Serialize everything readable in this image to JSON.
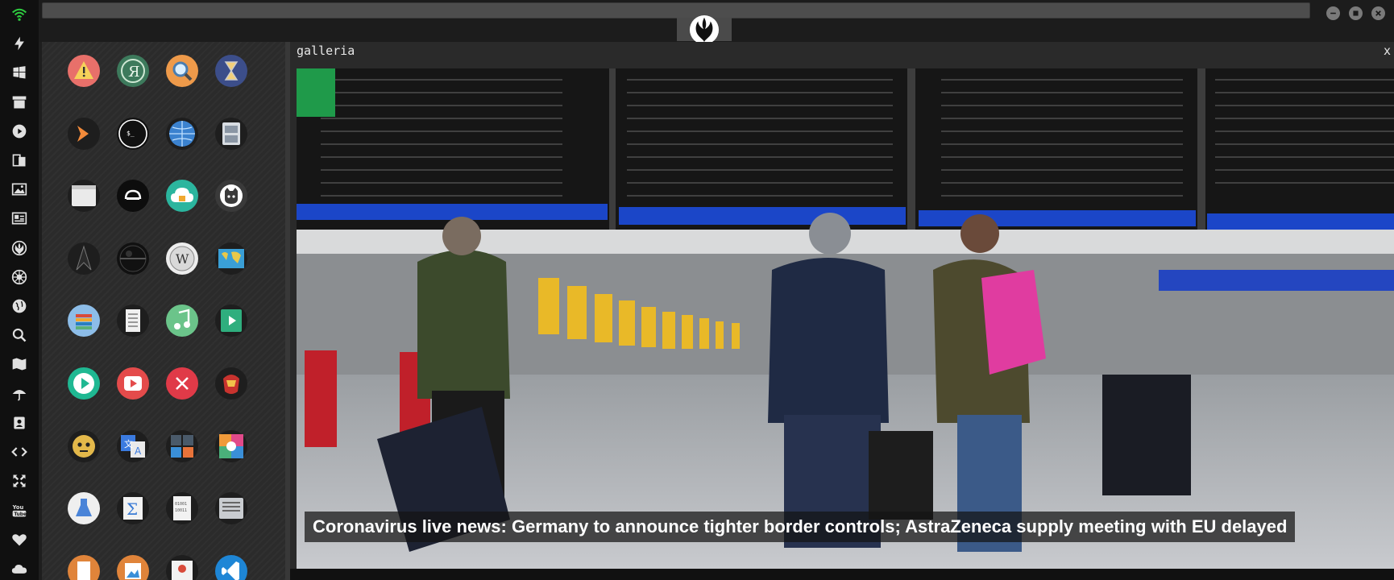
{
  "browser": {
    "url": "",
    "active_tab_icon": "rebel-alliance-icon",
    "window_controls": [
      "minimize-icon",
      "maximize-icon",
      "close-icon"
    ]
  },
  "dock": {
    "items": [
      "wifi-icon",
      "bolt-icon",
      "windows-icon",
      "archive-icon",
      "play-circle-icon",
      "translate-icon",
      "image-icon",
      "newspaper-icon",
      "rebel-alliance-icon",
      "empire-icon",
      "globe-icon",
      "search-icon",
      "map-icon",
      "umbrella-icon",
      "contact-icon",
      "code-icon",
      "expand-icon",
      "youtube-icon",
      "heart-icon",
      "cloud-icon"
    ],
    "colors": {
      "wifi": "#2ecc40",
      "default": "#e0e0e0"
    }
  },
  "apps": [
    "warning-icon",
    "yandex-icon",
    "search-icon",
    "hourglass-icon",
    "terminal-prompt-icon",
    "console-icon",
    "globe-icon",
    "file-cabinet-icon",
    "window-icon",
    "typing-icon",
    "cloud-lock-icon",
    "github-icon",
    "starfleet-icon",
    "death-star-icon",
    "wikipedia-icon",
    "world-map-icon",
    "books-icon",
    "document-icon",
    "music-icon",
    "video-icon",
    "play-icon",
    "youtube-icon",
    "close-circle-icon",
    "iron-man-icon",
    "c3po-icon",
    "translate-icon",
    "calculator-icon",
    "photo-viewer-icon",
    "flask-icon",
    "sigma-icon",
    "binary-file-icon",
    "text-editor-icon",
    "document-orange-icon",
    "image-orange-icon",
    "presentation-icon",
    "vscode-icon"
  ],
  "gallery": {
    "title": "galleria",
    "close_label": "x",
    "caption": "Coronavirus live news: Germany to announce tighter border controls; AstraZeneca supply meeting with EU delayed"
  }
}
